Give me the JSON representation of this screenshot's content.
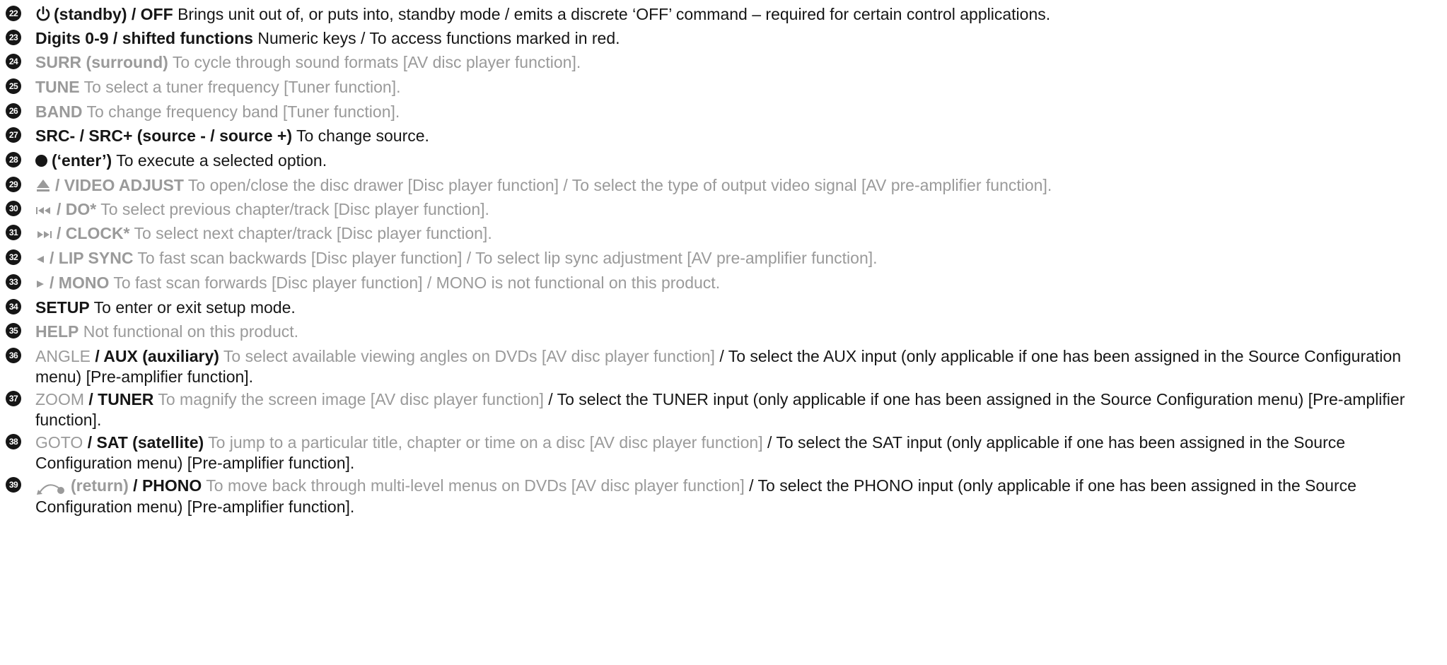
{
  "items": [
    {
      "num": "22",
      "key": "(standby) / OFF",
      "desc": "Brings unit out of, or puts into, standby mode / emits a discrete ‘OFF’ command – required for certain control applications."
    },
    {
      "num": "23",
      "key": "Digits 0-9 / shifted functions",
      "desc": "Numeric keys / To access functions marked in red."
    },
    {
      "num": "24",
      "key": "SURR (surround)",
      "desc": "To cycle through sound formats [AV disc player function]."
    },
    {
      "num": "25",
      "key": "TUNE",
      "desc": "To select a tuner frequency [Tuner function]."
    },
    {
      "num": "26",
      "key": "BAND",
      "desc": "To change frequency band [Tuner function]."
    },
    {
      "num": "27",
      "key": "SRC- / SRC+ (source - / source +)",
      "desc": "To change source."
    },
    {
      "num": "28",
      "key": "(‘enter’)",
      "desc": "To execute a selected option."
    },
    {
      "num": "29",
      "key": "/ VIDEO ADJUST",
      "desc": "To open/close the disc drawer [Disc player function] / To select the type of output video signal [AV pre-amplifier function]."
    },
    {
      "num": "30",
      "key": "/ DO*",
      "desc": "To select previous chapter/track [Disc player function]."
    },
    {
      "num": "31",
      "key": "/ CLOCK*",
      "desc": "To select next chapter/track [Disc player function]."
    },
    {
      "num": "32",
      "key": "/ LIP SYNC",
      "desc": "To fast scan backwards [Disc player function] /  To select lip sync adjustment [AV pre-amplifier function]."
    },
    {
      "num": "33",
      "key": "/ MONO",
      "desc": "To fast scan forwards [Disc player function] / MONO is not functional on this product."
    },
    {
      "num": "34",
      "key": "SETUP",
      "desc": "To enter or exit setup mode."
    },
    {
      "num": "35",
      "key": "HELP",
      "desc": "Not functional on this product."
    },
    {
      "num": "36",
      "key": "ANGLE",
      "key2": "/ AUX (auxiliary)",
      "desc": "To select available viewing angles on DVDs [AV disc player function]",
      "desc2": "/ To select the AUX input (only applicable if one has been assigned in the Source Configuration menu) [Pre-amplifier function]."
    },
    {
      "num": "37",
      "key": "ZOOM",
      "key2": "/ TUNER",
      "desc": "To magnify the screen image [AV disc player function]",
      "desc2": "/ To select the TUNER input (only applicable if one has been assigned in the Source Configuration menu) [Pre-amplifier function]."
    },
    {
      "num": "38",
      "key": "GOTO",
      "key2": "/ SAT (satellite)",
      "desc": "To jump to a particular title, chapter or time on a disc [AV disc player function]",
      "desc2": "/ To select the SAT input (only applicable if one has been assigned in the Source Configuration menu) [Pre-amplifier function]."
    },
    {
      "num": "39",
      "key": "(return)",
      "key2": "/ PHONO",
      "desc": "To move back through multi-level menus on DVDs [AV disc player function]",
      "desc2": "/ To select the PHONO input (only applicable if one has been assigned in the Source Configuration menu) [Pre-amplifier function]."
    }
  ],
  "colors": {
    "text": "#161616",
    "grey": "#9a9a9a",
    "badge": "#161616"
  },
  "icons": [
    "power-icon",
    "enter-dot-icon",
    "eject-icon",
    "skip-previous-icon",
    "skip-next-icon",
    "rewind-icon",
    "play-icon",
    "return-icon"
  ]
}
